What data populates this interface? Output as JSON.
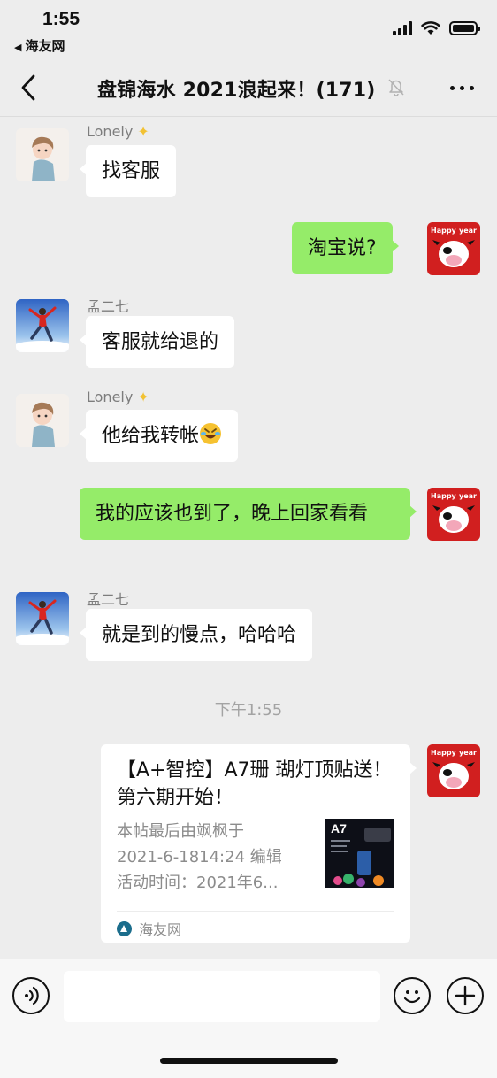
{
  "status_bar": {
    "time": "1:55",
    "back_app": "海友网",
    "icons": [
      "signal-icon",
      "wifi-icon",
      "battery-icon"
    ]
  },
  "nav": {
    "title": "盘锦海水 2021浪起来！(171)",
    "icons": [
      "back-icon",
      "mute-bell-icon",
      "more-icon"
    ]
  },
  "messages": [
    {
      "sender": "Lonely",
      "sender_badge": "star-icon",
      "text": "找客服",
      "direction": "incoming"
    },
    {
      "sender": "",
      "text": "淘宝说?",
      "direction": "outgoing"
    },
    {
      "sender": "孟二七",
      "text": "客服就给退的",
      "direction": "incoming"
    },
    {
      "sender": "Lonely",
      "sender_badge": "star-icon",
      "text": "他给我转帐",
      "emoji": "rolling-laughing-emoji",
      "direction": "incoming"
    },
    {
      "sender": "",
      "text": "我的应该也到了，晚上回家看看",
      "direction": "outgoing"
    },
    {
      "sender": "孟二七",
      "text": "就是到的慢点，哈哈哈",
      "direction": "incoming"
    }
  ],
  "timestamp": "下午1:55",
  "link_card": {
    "title": "【A+智控】A7珊 瑚灯顶贴送！第六期开始！",
    "desc_lines": [
      "本帖最后由飒枫于",
      "2021-6-1814:24 编辑",
      "活动时间：2021年6..."
    ],
    "thumb_label": "A7",
    "source": "海友网"
  },
  "input_bar": {
    "placeholder": "",
    "icons": [
      "voice-icon",
      "emoji-face-icon",
      "plus-icon"
    ]
  },
  "colors": {
    "background": "#ededed",
    "outgoing_bubble": "#95ec69",
    "incoming_bubble": "#ffffff",
    "meta_text": "#7d7d7d"
  }
}
